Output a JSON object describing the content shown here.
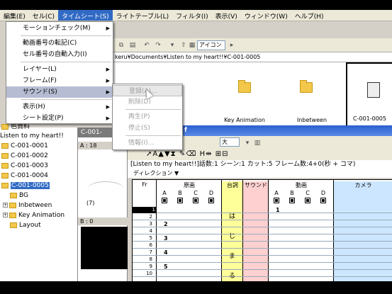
{
  "menubar": {
    "items": [
      "編集(E)",
      "セル(C)",
      "タイムシート(S)",
      "ライトテーブル(L)",
      "フィルタ(I)",
      "表示(V)",
      "ウィンドウ(W)",
      "ヘルプ(H)"
    ]
  },
  "timesheet_menu": {
    "items": [
      "モーションチェック(M)",
      "動画番号の転記(C)",
      "セル番号の自動入力(I)",
      "レイヤー(L)",
      "フレーム(F)",
      "サウンド(S)",
      "表示(H)",
      "シート設定(P)"
    ]
  },
  "sound_submenu": {
    "items": [
      "登録(A)...",
      "削除(D)",
      "再生(P)",
      "停止(S)",
      "情報(I)..."
    ]
  },
  "toolbar": {
    "view_label": "アイコン"
  },
  "path": "keru¥Documents¥Listen to my heart!!¥C-001-0005",
  "files": [
    {
      "label": ""
    },
    {
      "label": ""
    },
    {
      "label": "Key Animation"
    },
    {
      "label": "Inbetween"
    },
    {
      "label": "C-001-0005"
    }
  ],
  "tree": {
    "partial_top": "色資料",
    "root": "Listen to my heart!!",
    "items": [
      "C-001-0001",
      "C-001-0002",
      "C-001-0003",
      "C-001-0004",
      "C-001-0005",
      "BG",
      "Inbetween",
      "Key Animation",
      "Layout"
    ]
  },
  "preview": {
    "title": "C-001-",
    "layer_a": "A : 18",
    "value_7": "(7)",
    "layer_b": "B : 0"
  },
  "timesheet": {
    "title": "f",
    "size_value": "大",
    "info": "[Listen to my heart!!]話数:1 シーン:1 カット:5 フレーム数:4+0(秒 + コマ)",
    "direction": "ディレクション",
    "headers": {
      "fr": "Fr",
      "genga": "原画",
      "serifu": "台詞",
      "sound": "サウンド",
      "douga": "動画",
      "camera": "カメラ"
    },
    "cols_genga": [
      "A",
      "B",
      "C",
      "D"
    ],
    "cols_douga": [
      "A",
      "B",
      "C",
      "D"
    ],
    "frames": [
      "1",
      "2",
      "3",
      "4",
      "5",
      "6",
      "7",
      "8",
      "9",
      "10"
    ],
    "genga_a": [
      "",
      "",
      "2",
      "",
      "3",
      "",
      "4",
      "",
      "5",
      ""
    ],
    "douga_a": [
      "1",
      "",
      "",
      "",
      "",
      "",
      "",
      "",
      "",
      ""
    ],
    "serifu_chars": [
      "は",
      "じ",
      "ま",
      "る"
    ]
  }
}
